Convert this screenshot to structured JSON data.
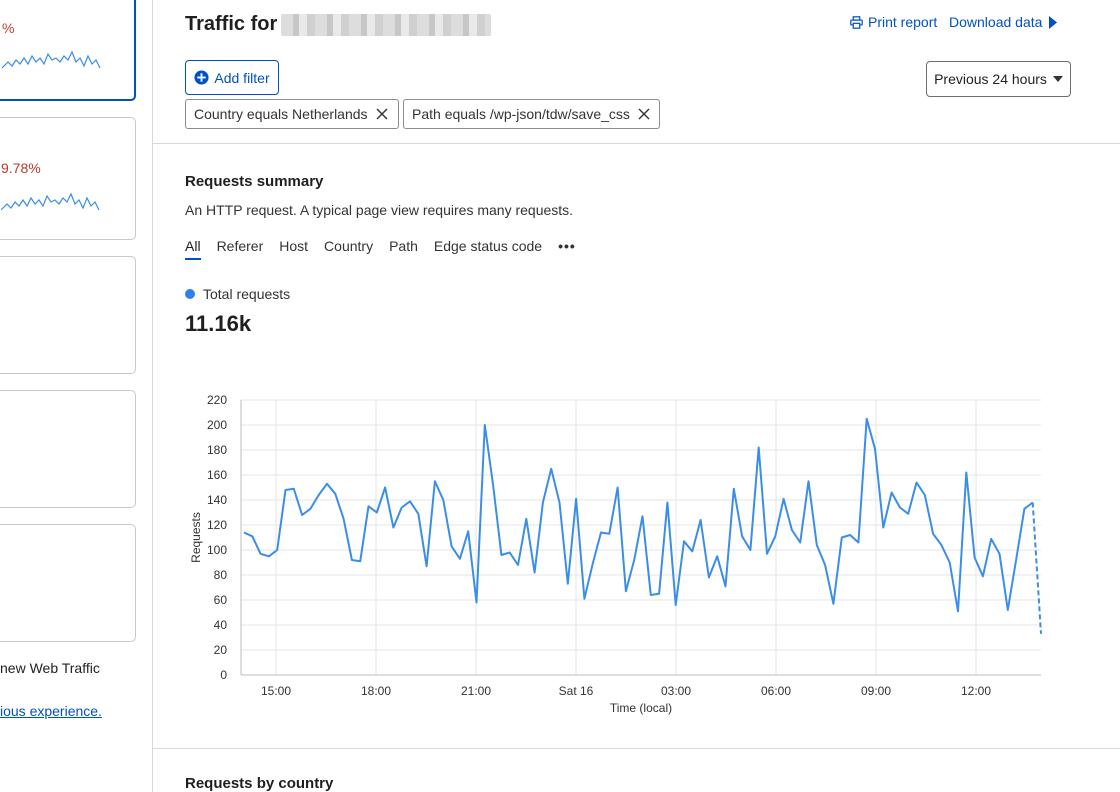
{
  "left": {
    "card1_pct": "%",
    "card2_pct": "9.78%",
    "note": " new Web Traffic",
    "link": "ious experience."
  },
  "header": {
    "title": "Traffic for",
    "print_label": "Print report",
    "download_label": "Download data"
  },
  "filters": {
    "add_label": "Add filter",
    "chips": [
      "Country equals Netherlands",
      "Path equals /wp-json/tdw/save_css"
    ],
    "time_range": "Previous 24 hours"
  },
  "summary": {
    "title": "Requests summary",
    "description": "An HTTP request. A typical page view requires many requests.",
    "tabs": [
      "All",
      "Referer",
      "Host",
      "Country",
      "Path",
      "Edge status code"
    ],
    "more": "•••",
    "legend_label": "Total requests",
    "total": "11.16k"
  },
  "colors": {
    "accent": "#0051c3",
    "series": "#3b8ee8",
    "negative": "#c0392b"
  },
  "icons": {
    "print": "printer-icon",
    "download": "caret-right-icon",
    "add": "plus-circle-icon",
    "remove": "close-icon",
    "dropdown": "caret-down-icon"
  },
  "chart_data": {
    "type": "line",
    "xlabel": "Time (local)",
    "ylabel": "Requests",
    "ylim": [
      0,
      220
    ],
    "yticks": [
      0,
      20,
      40,
      60,
      80,
      100,
      120,
      140,
      160,
      180,
      200,
      220
    ],
    "xticks": [
      "15:00",
      "18:00",
      "21:00",
      "Sat 16",
      "03:00",
      "06:00",
      "09:00",
      "12:00"
    ],
    "grid": true,
    "series": [
      {
        "name": "Total requests",
        "values": [
          114,
          111,
          97,
          95,
          100,
          148,
          149,
          128,
          133,
          144,
          153,
          145,
          125,
          92,
          91,
          135,
          130,
          150,
          118,
          134,
          139,
          129,
          87,
          155,
          140,
          103,
          93,
          115,
          58,
          200,
          152,
          96,
          98,
          88,
          125,
          82,
          138,
          165,
          138,
          73,
          141,
          61,
          89,
          114,
          113,
          150,
          67,
          92,
          127,
          64,
          65,
          138,
          56,
          107,
          99,
          124,
          78,
          95,
          71,
          149,
          111,
          100,
          182,
          97,
          111,
          141,
          116,
          106,
          155,
          104,
          88,
          57,
          110,
          112,
          106,
          205,
          181,
          118,
          146,
          134,
          129,
          154,
          144,
          113,
          104,
          90,
          51,
          162,
          94,
          79,
          109,
          97,
          52,
          92,
          133,
          138,
          33
        ]
      }
    ]
  },
  "section2": {
    "title": "Requests by country"
  }
}
